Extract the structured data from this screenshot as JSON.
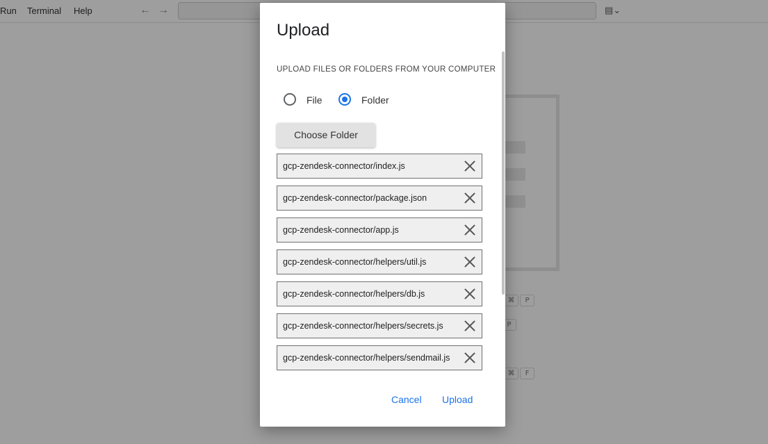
{
  "menubar": {
    "items": [
      "Run",
      "Terminal",
      "Help"
    ],
    "back": "←",
    "forward": "→"
  },
  "background": {
    "shortcut_keys": [
      "⌘",
      "P",
      "P",
      "⌘",
      "F"
    ]
  },
  "dialog": {
    "title": "Upload",
    "section_label": "UPLOAD FILES OR FOLDERS FROM YOUR COMPUTER",
    "options": [
      {
        "label": "File",
        "selected": false
      },
      {
        "label": "Folder",
        "selected": true
      }
    ],
    "choose_button": "Choose Folder",
    "files": [
      "gcp-zendesk-connector/index.js",
      "gcp-zendesk-connector/package.json",
      "gcp-zendesk-connector/app.js",
      "gcp-zendesk-connector/helpers/util.js",
      "gcp-zendesk-connector/helpers/db.js",
      "gcp-zendesk-connector/helpers/secrets.js",
      "gcp-zendesk-connector/helpers/sendmail.js"
    ],
    "cancel": "Cancel",
    "upload": "Upload"
  },
  "colors": {
    "accent": "#1a73e8",
    "overlay": "rgba(0,0,0,0.38)"
  }
}
